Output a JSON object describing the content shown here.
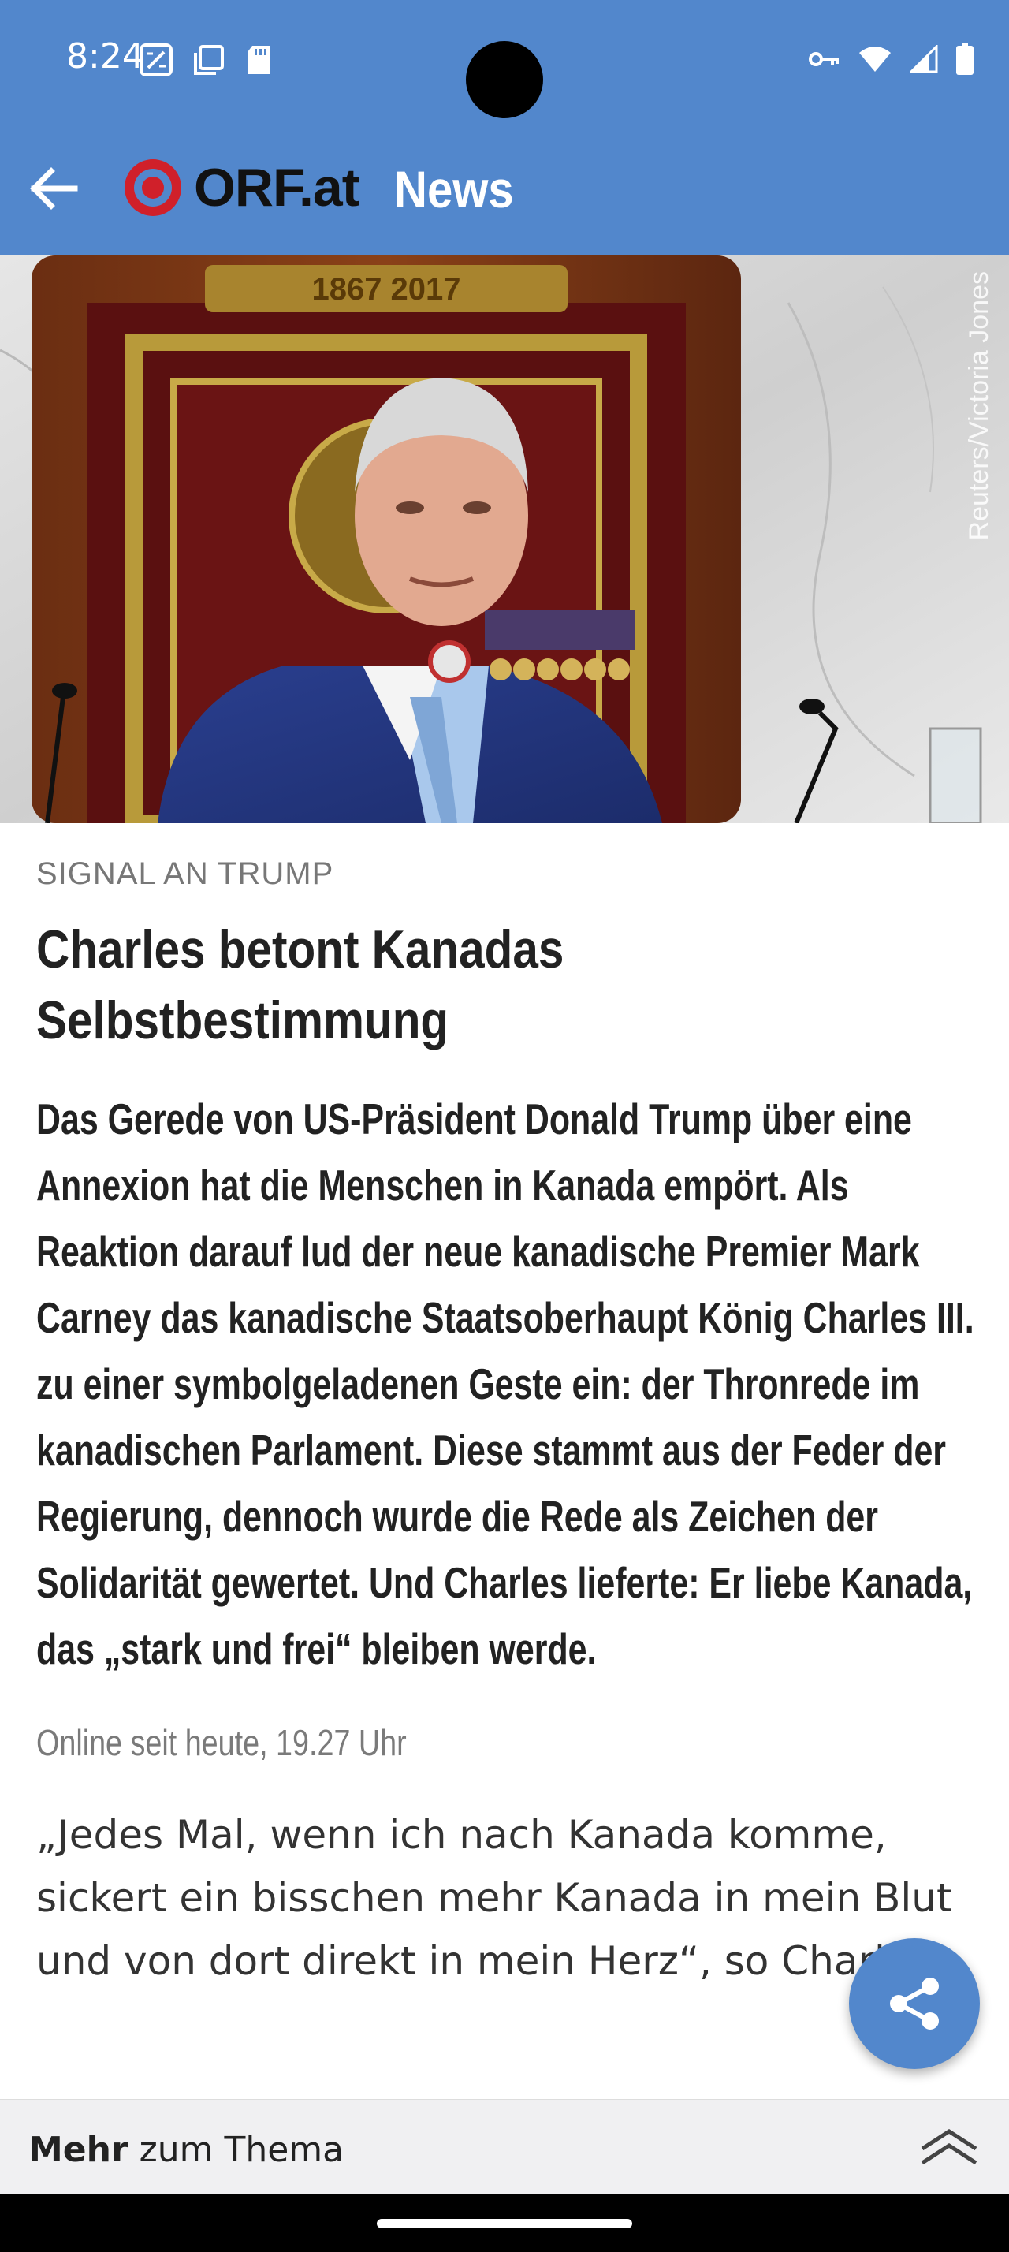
{
  "status_bar": {
    "time": "8:24",
    "icons": [
      "calculator-icon",
      "copy-icon",
      "sd-card-icon",
      "key-icon",
      "wifi-icon",
      "signal-icon",
      "battery-icon"
    ]
  },
  "app_bar": {
    "logo_text": "ORF.at",
    "section": "News"
  },
  "hero": {
    "credit": "Reuters/Victoria Jones",
    "plaque_text": "1867 2017"
  },
  "article": {
    "kicker": "SIGNAL AN TRUMP",
    "headline": "Charles betont Kanadas Selbstbestimmung",
    "lead": "Das Gerede von US-Präsident Donald Trump über eine Annexion hat die Menschen in Kanada empört. Als Reaktion darauf lud der neue kanadische Premier Mark Carney das kanadische Staatsoberhaupt König Charles III. zu einer symbolgeladenen Geste ein: der Thronrede im kanadischen Parlament. Diese stammt aus der Feder der Regierung, dennoch wurde die Rede als Zeichen der Solidarität gewertet. Und Charles lieferte: Er liebe Kanada, das „stark und frei“ bleiben werde.",
    "dateline": "Online seit heute, 19.27 Uhr",
    "body": "„Jedes Mal, wenn ich nach Kanada komme, sickert ein bisschen mehr Kanada in mein Blut und von dort direkt in mein Herz“, so Charles."
  },
  "bottom": {
    "more_bold": "Mehr",
    "more_rest": " zum Thema"
  },
  "colors": {
    "brand_blue": "#5287cc",
    "orf_red": "#d0202a"
  }
}
